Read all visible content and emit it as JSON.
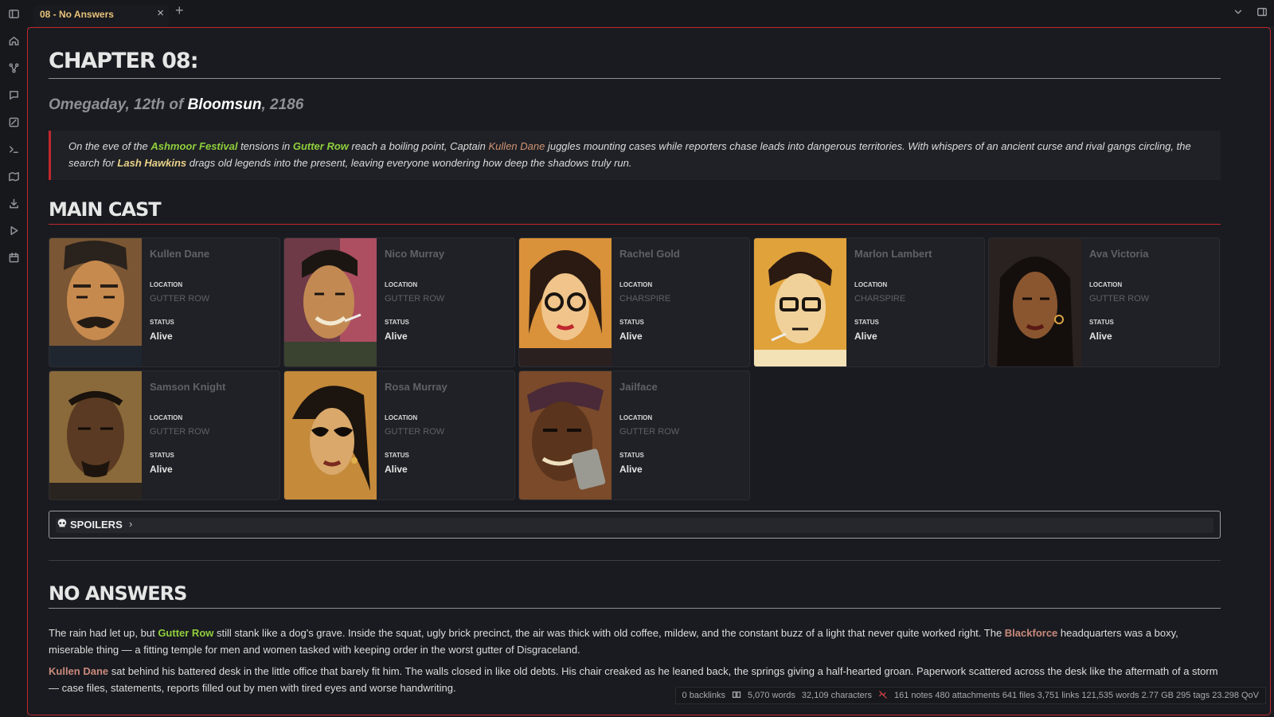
{
  "tab": {
    "title": "08 - No Answers",
    "close": "×",
    "new": "+"
  },
  "note": {
    "heading": "CHAPTER 08:",
    "date": {
      "prefix": "Omegaday, 12th of ",
      "month": "Bloomsun",
      "suffix": ", 2186"
    },
    "summary": {
      "t1": "On the eve of the ",
      "l1": "Ashmoor Festival",
      "t2": " tensions in ",
      "l2": "Gutter Row",
      "t3": " reach a boiling point, Captain ",
      "l3": "Kullen Dane",
      "t4": " juggles mounting cases while reporters chase leads into dangerous territories. With whispers of an ancient curse and rival gangs circling, the search for ",
      "l4": "Lash Hawkins",
      "t5": " drags old legends into the present, leaving everyone wondering how deep the shadows truly run."
    },
    "cast_heading": "MAIN CAST",
    "cast_labels": {
      "location": "LOCATION",
      "status": "STATUS"
    },
    "cast": [
      {
        "name": "Kullen Dane",
        "location": "GUTTER ROW",
        "status": "Alive",
        "portrait": "portrait-mustached-man"
      },
      {
        "name": "Nico Murray",
        "location": "GUTTER ROW",
        "status": "Alive",
        "portrait": "portrait-grinning-man-cigarette"
      },
      {
        "name": "Rachel Gold",
        "location": "CHARSPIRE",
        "status": "Alive",
        "portrait": "portrait-woman-glasses"
      },
      {
        "name": "Marlon Lambert",
        "location": "CHARSPIRE",
        "status": "Alive",
        "portrait": "portrait-man-glasses-cigarette"
      },
      {
        "name": "Ava Victoria",
        "location": "GUTTER ROW",
        "status": "Alive",
        "portrait": "portrait-woman-earrings"
      },
      {
        "name": "Samson Knight",
        "location": "GUTTER ROW",
        "status": "Alive",
        "portrait": "portrait-stern-man"
      },
      {
        "name": "Rosa Murray",
        "location": "GUTTER ROW",
        "status": "Alive",
        "portrait": "portrait-woman-sunglasses"
      },
      {
        "name": "Jailface",
        "location": "GUTTER ROW",
        "status": "Alive",
        "portrait": "portrait-masked-man"
      }
    ],
    "spoilers": {
      "label": "SPOILERS",
      "chevron": "›"
    },
    "section_heading": "NO ANSWERS",
    "p1": {
      "t1": "The rain had let up, but ",
      "l1": "Gutter Row",
      "t2": " still stank like a dog's grave. Inside the squat, ugly brick precinct, the air was thick with old coffee, mildew, and the constant buzz of a light that never quite worked right. The ",
      "l2": "Blackforce",
      "t3": " headquarters was a boxy, miserable thing — a fitting temple for men and women tasked with keeping order in the worst gutter of Disgraceland."
    },
    "p2": {
      "l1": "Kullen Dane",
      "t1": " sat behind his battered desk in the little office that barely fit him. The walls closed in like old debts. His chair creaked as he leaned back, the springs giving a half-hearted groan. Paperwork scattered across the desk like the aftermath of a storm — case files, statements, reports filled out by men with tired eyes and worse handwriting."
    }
  },
  "status_bar": {
    "backlinks": "0 backlinks",
    "words": "5,070 words",
    "characters": "32,109 characters",
    "vault": "161 notes 480 attachments 641 files 3,751 links 121,535 words 2.77 GB 295 tags 23.298 QoV"
  },
  "colors": {
    "accent": "#c0282e",
    "tab_title": "#e8c37a",
    "link_green": "#8fcf3c",
    "link_rose": "#c98a7c"
  }
}
